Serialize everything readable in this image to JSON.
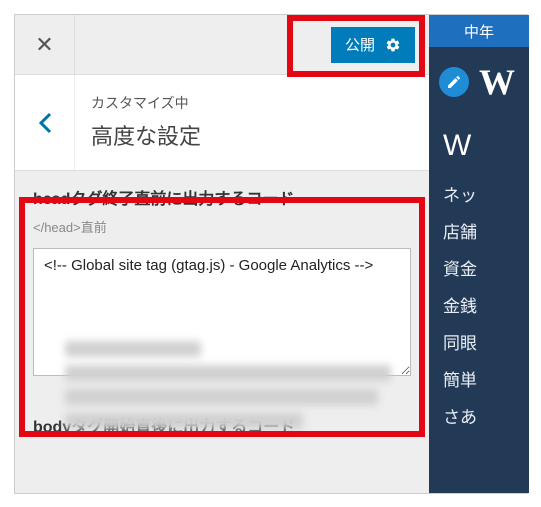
{
  "topbar": {
    "publish_label": "公開"
  },
  "breadcrumb": {
    "small": "カスタマイズ中",
    "large": "高度な設定"
  },
  "section_head": {
    "title": "headタグ終了直前に出力するコード",
    "sub": "</head>直前",
    "textarea_value": "<!-- Global site tag (gtag.js) - Google Analytics -->"
  },
  "section_body": {
    "title": "bodyタグ開始直後に出力するコード"
  },
  "preview": {
    "topbar": "中年",
    "logo_letter": "W",
    "heading": "W",
    "lines": [
      "ネッ",
      "店舗",
      "資金",
      "金銭",
      "同眼",
      "簡単",
      "さあ"
    ]
  }
}
